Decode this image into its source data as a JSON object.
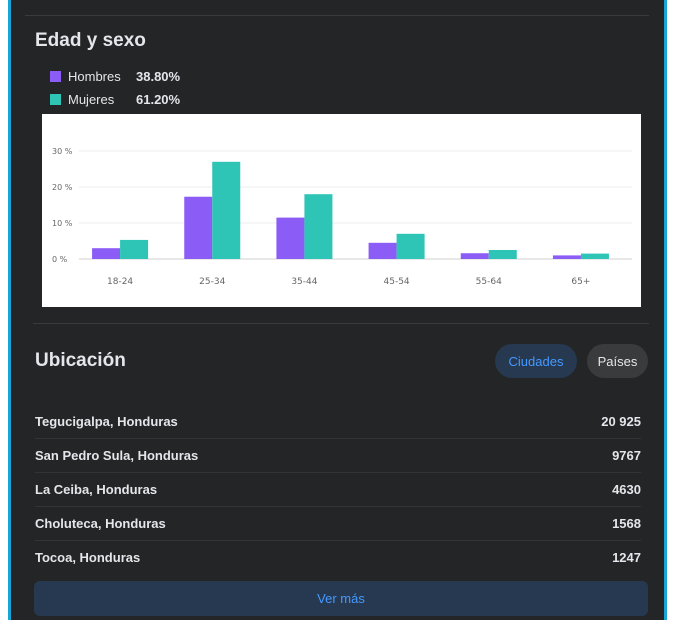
{
  "age_section": {
    "title": "Edad y sexo",
    "legend": [
      {
        "label": "Hombres",
        "value": "38.80%",
        "color": "#8b5cf6"
      },
      {
        "label": "Mujeres",
        "value": "61.20%",
        "color": "#2ec4b6"
      }
    ]
  },
  "chart_data": {
    "type": "bar",
    "categories": [
      "18-24",
      "25-34",
      "35-44",
      "45-54",
      "55-64",
      "65+"
    ],
    "series": [
      {
        "name": "Hombres",
        "values": [
          3,
          17.3,
          11.5,
          4.5,
          1.6,
          1.0
        ],
        "color": "#8b5cf6"
      },
      {
        "name": "Mujeres",
        "values": [
          5.3,
          27,
          18,
          7,
          2.5,
          1.5
        ],
        "color": "#2ec4b6"
      }
    ],
    "yticks": [
      "0 %",
      "10 %",
      "20 %",
      "30 %"
    ],
    "ytick_values": [
      0,
      10,
      20,
      30
    ],
    "ylim": [
      0,
      30
    ],
    "grid": true
  },
  "location_section": {
    "title": "Ubicación",
    "tabs": {
      "cities": "Ciudades",
      "countries": "Países"
    },
    "rows": [
      {
        "city": "Tegucigalpa, Honduras",
        "count": "20 925"
      },
      {
        "city": "San Pedro Sula, Honduras",
        "count": "9767"
      },
      {
        "city": "La Ceiba, Honduras",
        "count": "4630"
      },
      {
        "city": "Choluteca, Honduras",
        "count": "1568"
      },
      {
        "city": "Tocoa, Honduras",
        "count": "1247"
      }
    ],
    "more_label": "Ver más"
  }
}
